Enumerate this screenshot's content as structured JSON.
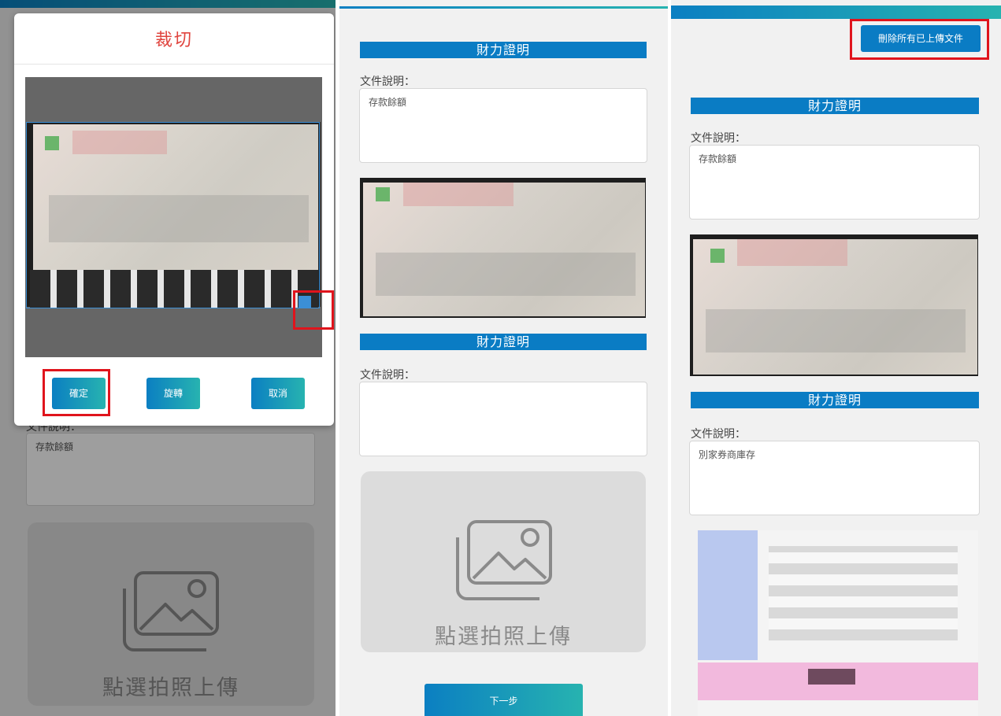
{
  "crop_modal": {
    "title": "裁切",
    "confirm_label": "確定",
    "rotate_label": "旋轉",
    "cancel_label": "取消"
  },
  "panel1_bg": {
    "label_partial": "文件說明：",
    "description": "存款餘額",
    "upload_text": "點選拍照上傳"
  },
  "panel2": {
    "sections": [
      {
        "title": "財力證明",
        "label": "文件說明：",
        "description": "存款餘額"
      },
      {
        "title": "財力證明",
        "label": "文件說明：",
        "description": ""
      }
    ],
    "upload_text": "點選拍照上傳",
    "next_label": "下一步"
  },
  "panel3": {
    "delete_all_label": "刪除所有已上傳文件",
    "sections": [
      {
        "title": "財力證明",
        "label": "文件說明：",
        "description": "存款餘額"
      },
      {
        "title": "財力證明",
        "label": "文件說明：",
        "description": "別家券商庫存"
      }
    ]
  },
  "colors": {
    "accent_blue": "#0a7cc4",
    "accent_teal": "#27b3b0",
    "title_red": "#e0443e",
    "highlight_red": "#e0141c"
  }
}
